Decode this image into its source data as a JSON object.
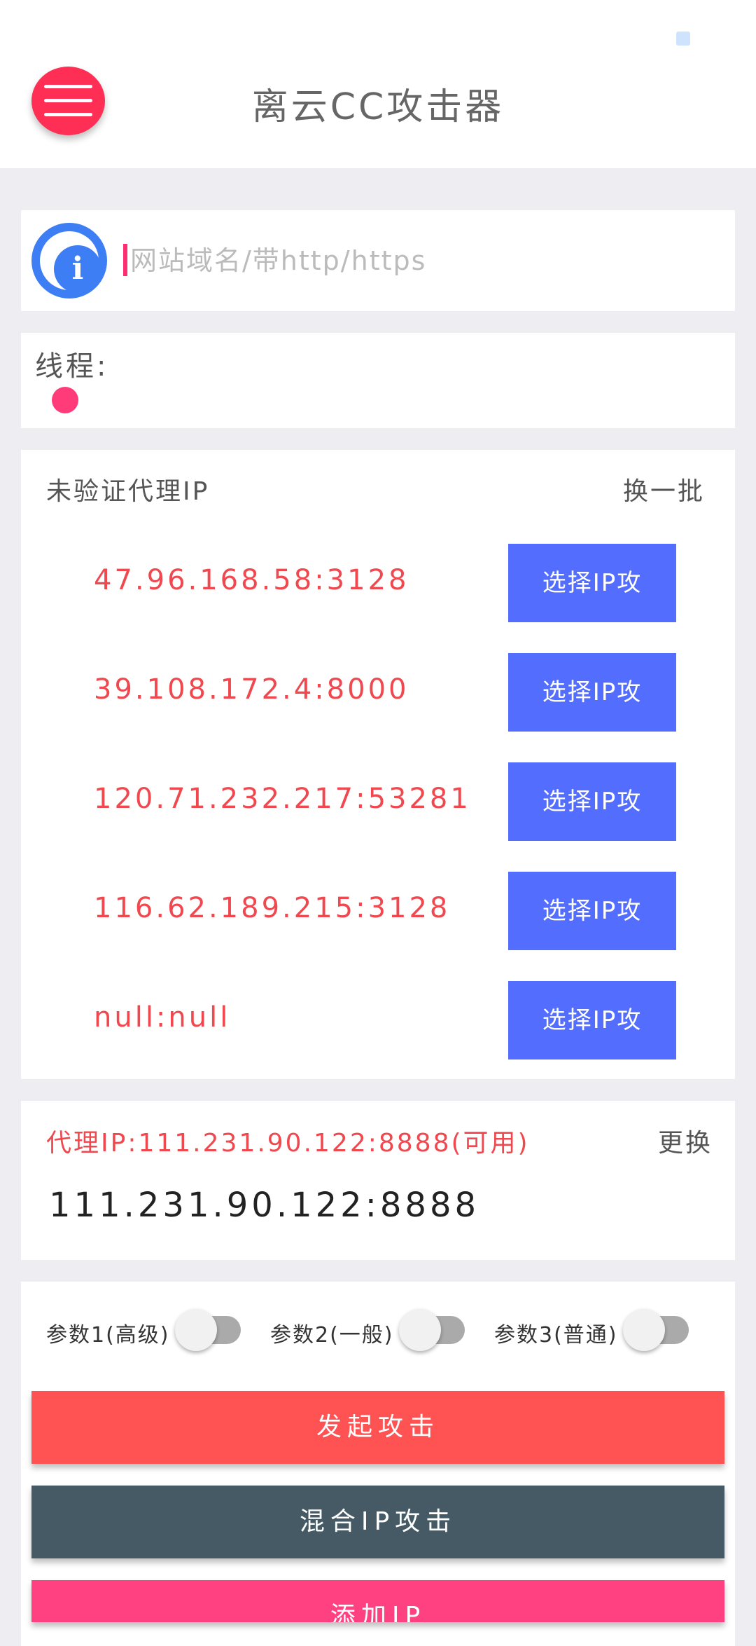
{
  "header": {
    "title": "离云CC攻击器"
  },
  "url_field": {
    "placeholder": "网站域名/带http/https",
    "value": ""
  },
  "threads": {
    "label": "线程:"
  },
  "proxy_list": {
    "title": "未验证代理IP",
    "refresh_label": "换一批",
    "items": [
      {
        "ip": "47.96.168.58:3128",
        "button": "选择IP攻"
      },
      {
        "ip": "39.108.172.4:8000",
        "button": "选择IP攻"
      },
      {
        "ip": "120.71.232.217:53281",
        "button": "选择IP攻"
      },
      {
        "ip": "116.62.189.215:3128",
        "button": "选择IP攻"
      },
      {
        "ip": "null:null",
        "button": "选择IP攻"
      }
    ]
  },
  "current_proxy": {
    "label": "代理IP:111.231.90.122:8888(可用)",
    "change_label": "更换",
    "ip": "111.231.90.122:8888"
  },
  "params": [
    {
      "label": "参数1(高级)",
      "on": false
    },
    {
      "label": "参数2(一般)",
      "on": false
    },
    {
      "label": "参数3(普通)",
      "on": false
    }
  ],
  "buttons": {
    "attack": "发起攻击",
    "mix_attack": "混合IP攻击",
    "add_ip": "添加IP"
  },
  "colors": {
    "menu_button": "#ff2e55",
    "ip_text": "#f0484f",
    "ip_button": "#536dfe",
    "attack": "#ff5252",
    "mix": "#455a64",
    "add": "#ff4081"
  },
  "icons": {
    "menu": "hamburger-icon",
    "info": "info-icon"
  }
}
